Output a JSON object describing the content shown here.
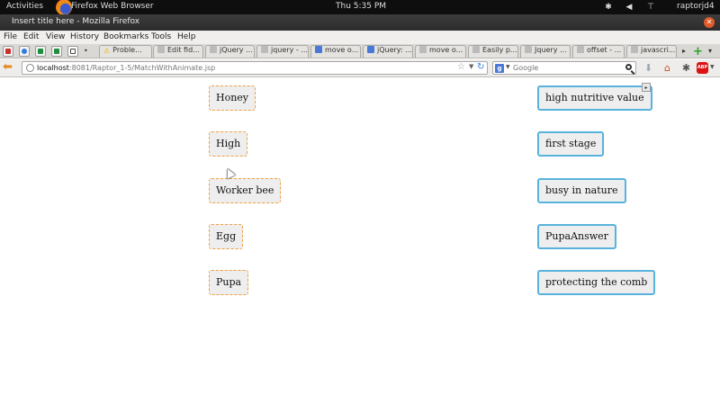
{
  "top_panel": {
    "activities": "Activities",
    "app_name": "Firefox Web Browser",
    "clock": "Thu  5:35 PM",
    "user": "raptorjd4",
    "tray_icons": [
      "accessibility-icon",
      "volume-icon",
      "network-icon"
    ]
  },
  "window": {
    "title": "Insert title here - Mozilla Firefox",
    "close_icon": "close-icon"
  },
  "menu": {
    "items": [
      "File",
      "Edit",
      "View",
      "History",
      "Bookmarks",
      "Tools",
      "Help"
    ]
  },
  "tabs": {
    "app_tabs": [
      {
        "icon": "gmail-icon",
        "color": "#c9302c"
      },
      {
        "icon": "chrome-icon",
        "color": "#2f7de1"
      },
      {
        "icon": "sheets-icon",
        "color": "#1e8e3e"
      },
      {
        "icon": "sheets-icon",
        "color": "#1e8e3e"
      },
      {
        "icon": "image-icon",
        "color": "#444444"
      }
    ],
    "items": [
      {
        "label": "Proble...",
        "icon": "warning-icon",
        "color": "#e8b000"
      },
      {
        "label": "Edit fid...",
        "icon": "page-icon",
        "color": "#bbbbbb"
      },
      {
        "label": "jQuery ...",
        "icon": "page-icon",
        "color": "#bbbbbb"
      },
      {
        "label": "jquery - ...",
        "icon": "page-icon",
        "color": "#bbbbbb"
      },
      {
        "label": "move o...",
        "icon": "google-icon",
        "color": "#4a78d6"
      },
      {
        "label": "jQuery: ...",
        "icon": "page-icon",
        "color": "#4a78d6"
      },
      {
        "label": "move o...",
        "icon": "page-icon",
        "color": "#bbbbbb"
      },
      {
        "label": "Easily p...",
        "icon": "page-icon",
        "color": "#bbbbbb"
      },
      {
        "label": "Jquery ...",
        "icon": "page-icon",
        "color": "#bbbbbb"
      },
      {
        "label": "offset - ...",
        "icon": "page-icon",
        "color": "#bbbbbb"
      },
      {
        "label": "javascri...",
        "icon": "page-icon",
        "color": "#bbbbbb"
      }
    ],
    "scroll_right": "▸",
    "list_all": "▾",
    "new_tab": "+"
  },
  "navbar": {
    "url_host": "localhost",
    "url_path": ":8081/Raptor_1-5/MatchWithAnimate.jsp",
    "search_placeholder": "Google",
    "search_engine": "g",
    "icons": [
      "back-arrow-icon",
      "star-icon",
      "reload-icon",
      "search-icon",
      "download-icon",
      "home-icon",
      "addon-icon",
      "adblock-icon"
    ],
    "abp_label": "ABP"
  },
  "page": {
    "left_items": [
      "Honey",
      "High",
      "Worker bee",
      "Egg",
      "Pupa"
    ],
    "right_items": [
      "high nutritive value",
      "first stage",
      "busy in nature",
      "PupaAnswer",
      "protecting the comb"
    ]
  },
  "colors": {
    "left_border": "#f0a040",
    "right_border": "#58b3dc",
    "item_bg": "#eeeeee"
  }
}
